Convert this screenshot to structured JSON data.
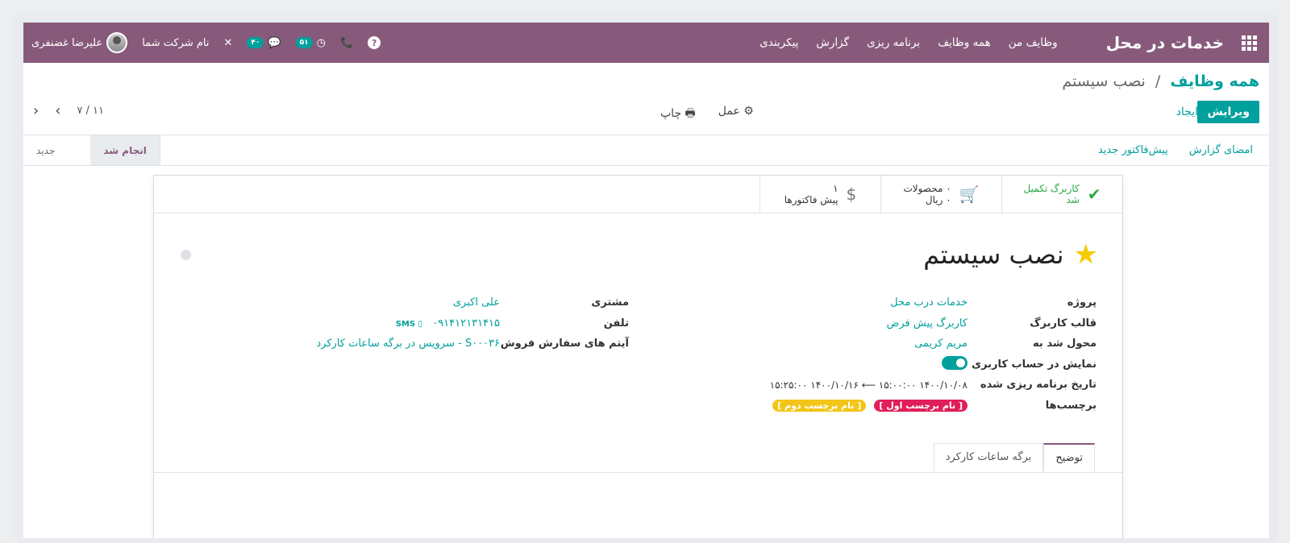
{
  "navbar": {
    "brand": "خدمات در محل",
    "menu": [
      "وظایف من",
      "همه وظایف",
      "برنامه ریزی",
      "گزارش",
      "پیکربندی"
    ],
    "help": "?",
    "activity_count": "۵۱",
    "messages_count": "۴۰",
    "company": "نام شرکت شما",
    "user": "علیرضا غضنفری"
  },
  "control": {
    "breadcrumb_parent": "همه وظایف",
    "breadcrumb_sep": "/",
    "breadcrumb_current": "نصب سیستم",
    "edit": "ویرایش",
    "create": "ایجاد",
    "print": "چاپ",
    "action": "عمل",
    "pager": "۱۱ / ۷"
  },
  "statusbar": {
    "buttons": [
      "امضای گزارش",
      "پیش‌فاکتور جدید"
    ],
    "stages": [
      "جدید",
      "انجام شد"
    ],
    "active_stage": "انجام شد"
  },
  "smart_buttons": {
    "worksheet": {
      "line1": "کاربرگ تکمیل",
      "line2": "شد"
    },
    "products": {
      "line1": "۰ محصولات",
      "line2": "۰ ریال"
    },
    "quotations": {
      "line1": "۱",
      "line2": "پیش فاکتورها"
    }
  },
  "record": {
    "title": "نصب سیستم",
    "fields_right": [
      {
        "label": "پروژه",
        "value": "خدمات درب محل"
      },
      {
        "label": "قالب کاربرگ",
        "value": "کاربرگ پیش فرض"
      },
      {
        "label": "محول شد به",
        "value": "مریم کریمی"
      },
      {
        "label": "نمایش در حساب کاربری",
        "value": ""
      },
      {
        "label": "تاریخ برنامه ریزی شده",
        "value": "۱۴۰۰/۱۰/۰۸ ۱۵:۰۰:۰۰  ⟵  ۱۴۰۰/۱۰/۱۶ ۱۵:۲۵:۰۰"
      },
      {
        "label": "برچسب‌ها",
        "value": ""
      }
    ],
    "tags": [
      "[ نام برچسب اول ]",
      "[ نام برچسب دوم ]"
    ],
    "fields_left": [
      {
        "label": "مشتری",
        "value": "علی اکبری"
      },
      {
        "label": "تلفن",
        "value": "۰۹۱۴۱۲۱۳۱۴۱۵"
      },
      {
        "label": "آیتم های سفارش فروش",
        "value": "S۰۰۰۳۶ - سرویس در برگه ساعات کارکرد"
      }
    ],
    "sms": "SMS"
  },
  "tabs": [
    "توضیح",
    "برگه ساعات کارکرد"
  ],
  "colors": {
    "primary": "#875a7b",
    "accent": "#00a09d",
    "tag_pink": "#e01e5a",
    "tag_yellow": "#f3c518",
    "star": "#f3cc00"
  }
}
